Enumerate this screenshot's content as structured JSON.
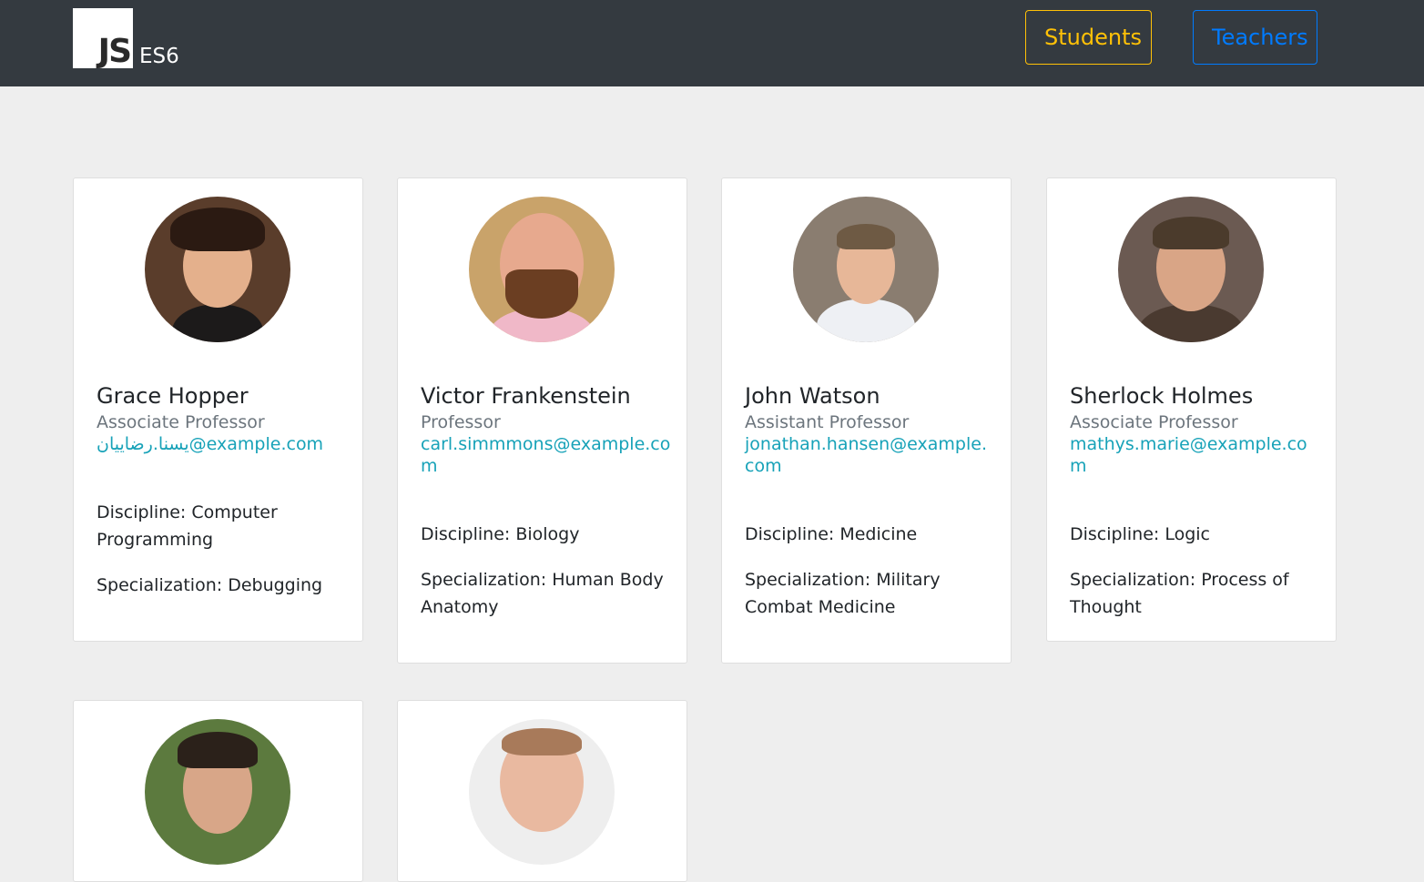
{
  "navbar": {
    "logo_text": "JS",
    "brand_text": "ES6",
    "students_label": "Students",
    "teachers_label": "Teachers"
  },
  "colors": {
    "navbar_bg": "#343a40",
    "students_accent": "#ffc107",
    "teachers_accent": "#007bff",
    "email_link": "#17a2b8"
  },
  "teachers": [
    {
      "name": "Grace Hopper",
      "title": "Associate Professor",
      "email": "يسنا.رضاییان@example.com",
      "discipline": "Discipline: Computer Programming",
      "specialization": "Specialization: Debugging"
    },
    {
      "name": "Victor Frankenstein",
      "title": "Professor",
      "email": "carl.simmmons@example.com",
      "discipline": "Discipline: Biology",
      "specialization": "Specialization: Human Body Anatomy"
    },
    {
      "name": "John Watson",
      "title": "Assistant Professor",
      "email": "jonathan.hansen@example.com",
      "discipline": "Discipline: Medicine",
      "specialization": "Specialization: Military Combat Medicine"
    },
    {
      "name": "Sherlock Holmes",
      "title": "Associate Professor",
      "email": "mathys.marie@example.com",
      "discipline": "Discipline: Logic",
      "specialization": "Specialization: Process of Thought"
    }
  ]
}
